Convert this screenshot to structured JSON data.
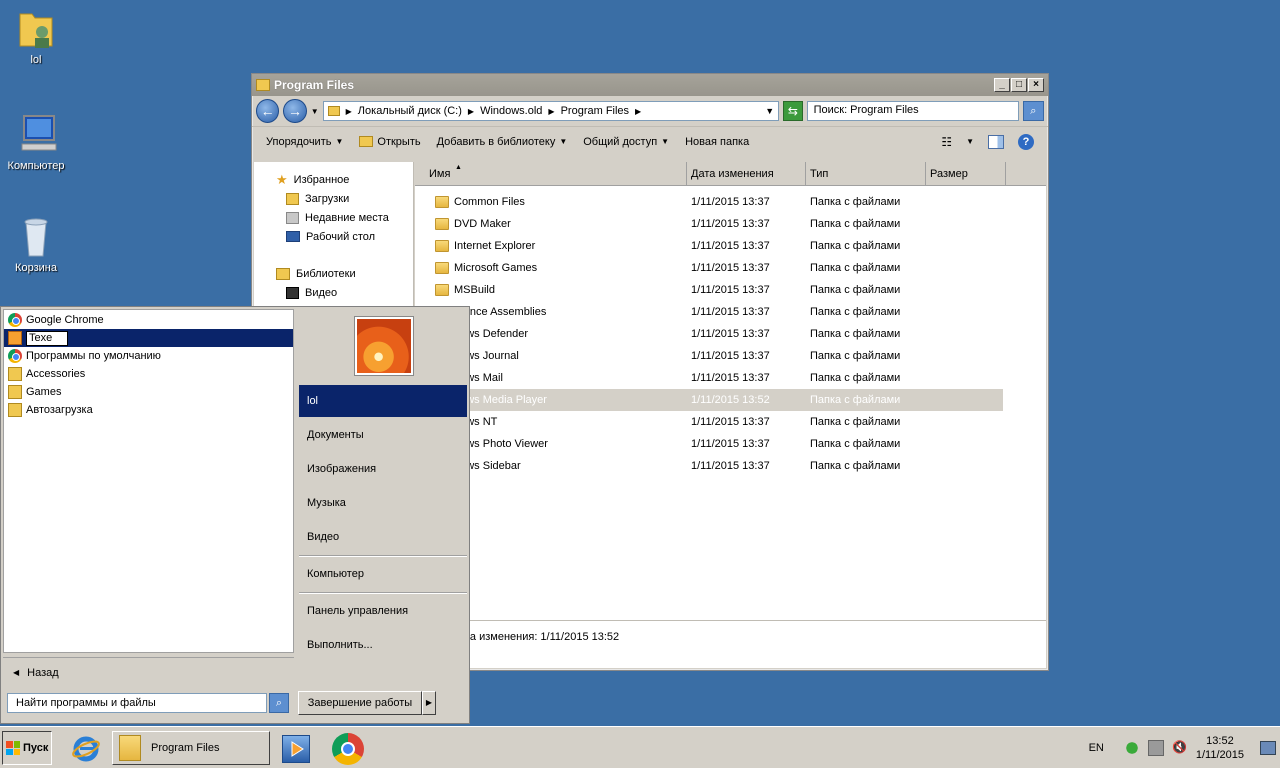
{
  "desktop": {
    "icons": [
      {
        "label": "lol"
      },
      {
        "label": "Компьютер"
      },
      {
        "label": "Корзина"
      }
    ]
  },
  "explorer": {
    "title": "Program Files",
    "address": [
      "Локальный диск (C:)",
      "Windows.old",
      "Program Files"
    ],
    "search_placeholder": "Поиск: Program Files",
    "toolbar": {
      "organize": "Упорядочить",
      "open": "Открыть",
      "add_library": "Добавить в библиотеку",
      "share": "Общий доступ",
      "new_folder": "Новая папка"
    },
    "nav": {
      "favorites": "Избранное",
      "downloads": "Загрузки",
      "recent": "Недавние места",
      "desktop": "Рабочий стол",
      "libraries": "Библиотеки",
      "video": "Видео"
    },
    "columns": {
      "name": "Имя",
      "date": "Дата изменения",
      "type": "Тип",
      "size": "Размер"
    },
    "files": [
      {
        "name": "Common Files",
        "date": "1/11/2015 13:37",
        "type": "Папка с файлами"
      },
      {
        "name": "DVD Maker",
        "date": "1/11/2015 13:37",
        "type": "Папка с файлами"
      },
      {
        "name": "Internet Explorer",
        "date": "1/11/2015 13:37",
        "type": "Папка с файлами"
      },
      {
        "name": "Microsoft Games",
        "date": "1/11/2015 13:37",
        "type": "Папка с файлами"
      },
      {
        "name": "MSBuild",
        "date": "1/11/2015 13:37",
        "type": "Папка с файлами"
      },
      {
        "name": "erence Assemblies",
        "date": "1/11/2015 13:37",
        "type": "Папка с файлами"
      },
      {
        "name": "dows Defender",
        "date": "1/11/2015 13:37",
        "type": "Папка с файлами"
      },
      {
        "name": "dows Journal",
        "date": "1/11/2015 13:37",
        "type": "Папка с файлами"
      },
      {
        "name": "dows Mail",
        "date": "1/11/2015 13:37",
        "type": "Папка с файлами"
      },
      {
        "name": "dows Media Player",
        "date": "1/11/2015 13:52",
        "type": "Папка с файлами"
      },
      {
        "name": "dows NT",
        "date": "1/11/2015 13:37",
        "type": "Папка с файлами"
      },
      {
        "name": "dows Photo Viewer",
        "date": "1/11/2015 13:37",
        "type": "Папка с файлами"
      },
      {
        "name": "dows Sidebar",
        "date": "1/11/2015 13:37",
        "type": "Папка с файлами"
      }
    ],
    "status": "та изменения:  1/11/2015 13:52"
  },
  "startmenu": {
    "programs": [
      {
        "label": "Google Chrome"
      },
      {
        "label": "Texe"
      },
      {
        "label": "Программы по умолчанию"
      },
      {
        "label": "Accessories"
      },
      {
        "label": "Games"
      },
      {
        "label": "Автозагрузка"
      }
    ],
    "back": "Назад",
    "search_placeholder": "Найти программы и файлы",
    "right": {
      "user": "lol",
      "documents": "Документы",
      "pictures": "Изображения",
      "music": "Музыка",
      "video": "Видео",
      "computer": "Компьютер",
      "control_panel": "Панель управления",
      "run": "Выполнить..."
    },
    "shutdown": "Завершение работы"
  },
  "taskbar": {
    "start": "Пуск",
    "task": "Program Files",
    "lang": "EN",
    "time": "13:52",
    "date": "1/11/2015"
  }
}
